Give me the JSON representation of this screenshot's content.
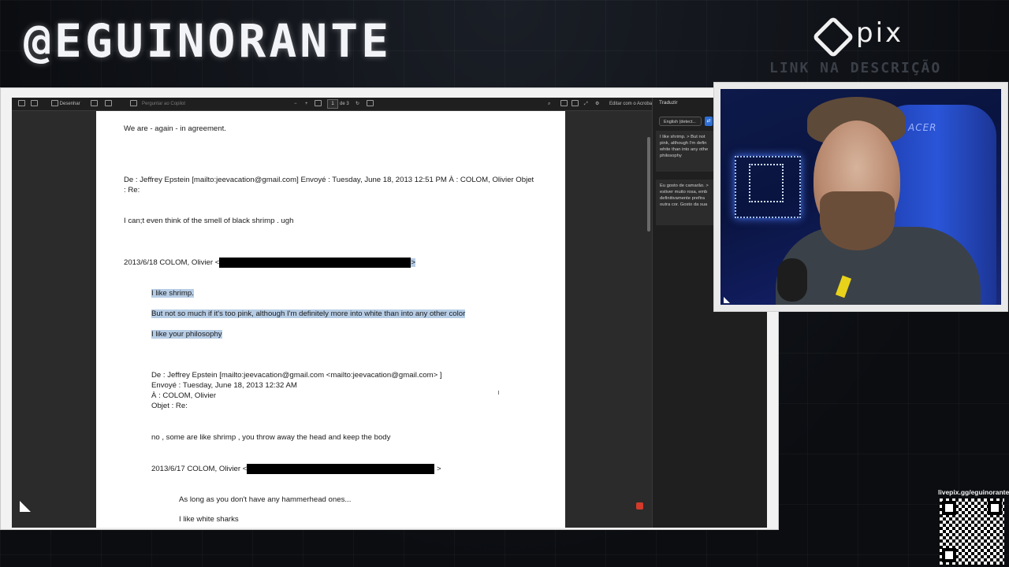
{
  "overlay": {
    "handle": "@EGUINORANTE",
    "pix_label": "pix",
    "link_description": "LINK NA DESCRIÇÃO",
    "qr_url": "livepix.gg/eguinorante"
  },
  "toolbar": {
    "draw_label": "Desenhar",
    "ask_label": "Perguntar ao Copilot",
    "page_current": "1",
    "page_total": "de 3",
    "edit_acrobat": "Editar com o Acrobat"
  },
  "document": {
    "lines": [
      "We are - again - in agreement.",
      "De : Jeffrey Epstein [mailto:jeevacation@gmail.com] Envoyé : Tuesday, June 18, 2013 12:51 PM À : COLOM, Olivier Objet",
      ": Re:",
      "I can;t even think of the smell  of black shrimp  . ugh",
      "2013/6/18 COLOM, Olivier <",
      ">",
      "I like shrimp.",
      "But not so much if it's too pink, although I'm definitely more into white than into any other color",
      "I like your philosophy",
      "De : Jeffrey Epstein [mailto:jeevacation@gmail.com <mailto:jeevacation@gmail.com> ]",
      "Envoyé : Tuesday, June 18, 2013 12:32 AM",
      "À : COLOM, Olivier",
      "Objet : Re:",
      "no , some are like shrimp  , you throw away the head and  keep the body",
      "2013/6/17 COLOM, Olivier <",
      ">",
      "As long as you don't have any hammerhead ones...",
      "I like white sharks"
    ]
  },
  "translate": {
    "title": "Traduzir",
    "source_lang": "English (detect...",
    "swap_label": "⇄",
    "source_text": "I like shrimp. > But not\npink, although I'm defin\nwhite than into any othe\nphilosophy",
    "translated_text": "Eu gosto de camarão. >\nestiver muito rosa, emb\ndefinitivamente prefira\noutra cor. Gosto da sua"
  },
  "webcam": {
    "chair_brand": "ACER"
  }
}
